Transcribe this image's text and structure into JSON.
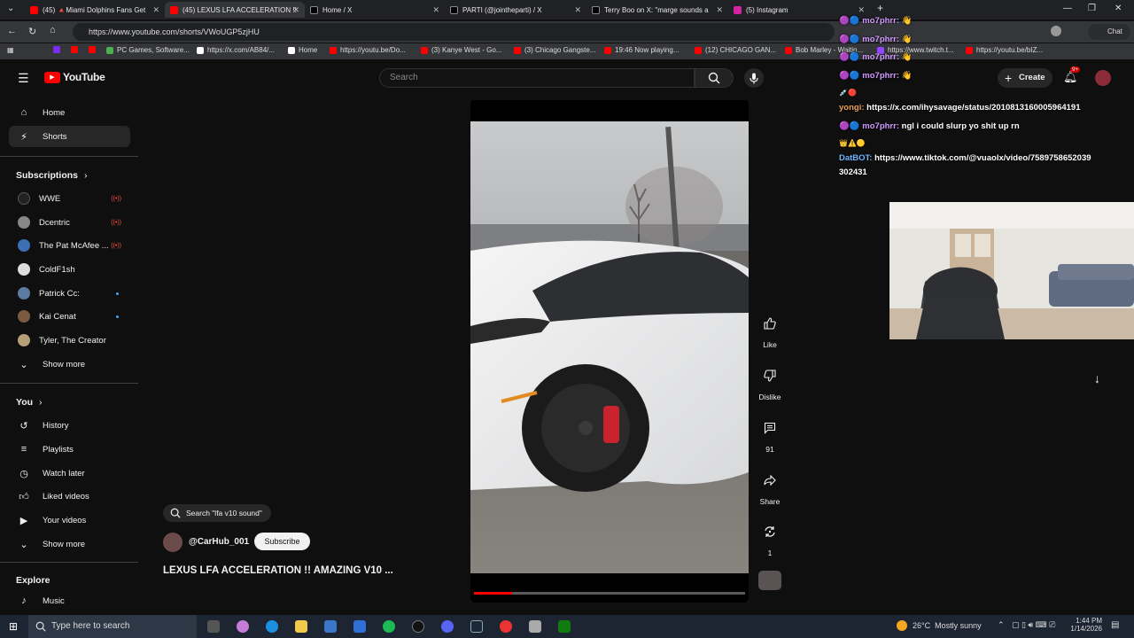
{
  "browser": {
    "tabs": [
      {
        "title": "(45) 🔺Miami Dolphins Fans Get",
        "color": "#ff0000"
      },
      {
        "title": "(45) LEXUS LFA ACCELERATION !!",
        "color": "#ff0000"
      },
      {
        "title": "Home / X",
        "color": "#000000"
      },
      {
        "title": "PARTI (@jointheparti) / X",
        "color": "#000000"
      },
      {
        "title": "Terry Boo on X: \"marge sounds a",
        "color": "#000000"
      },
      {
        "title": "(5) Instagram",
        "color": "#d6249f"
      }
    ],
    "url": "https://www.youtube.com/shorts/VWoUGP5zjHU",
    "bookmarks": [
      "PC Games, Software...",
      "https://x.com/AB84/...",
      "Home",
      "https://youtu.be/Do...",
      "(3) Kanye West - Go...",
      "(3) Chicago Gangste...",
      "19:46 Now playing...",
      "(12) CHICAGO GAN...",
      "Bob Marley - Waitin...",
      "https://www.twitch.t...",
      "https://youtu.be/bIZ..."
    ],
    "chat_button": "Chat"
  },
  "youtube": {
    "logo": "YouTube",
    "search_placeholder": "Search",
    "create_label": "Create",
    "notif_count": "9+",
    "nav": [
      {
        "label": "Home",
        "icon": "home-icon"
      },
      {
        "label": "Shorts",
        "icon": "shorts-icon"
      }
    ],
    "subscriptions_header": "Subscriptions",
    "subscriptions": [
      {
        "label": "WWE",
        "status": "live"
      },
      {
        "label": "Dcentric",
        "status": "live"
      },
      {
        "label": "The Pat McAfee ...",
        "status": "live"
      },
      {
        "label": "ColdF1sh",
        "status": ""
      },
      {
        "label": "Patrick Cc:",
        "status": "new"
      },
      {
        "label": "Kai Cenat",
        "status": "new"
      },
      {
        "label": "Tyler, The Creator",
        "status": ""
      }
    ],
    "show_more": "Show more",
    "you_header": "You",
    "you_items": [
      {
        "label": "History",
        "icon": "history-icon"
      },
      {
        "label": "Playlists",
        "icon": "playlists-icon"
      },
      {
        "label": "Watch later",
        "icon": "watch-later-icon"
      },
      {
        "label": "Liked videos",
        "icon": "liked-icon"
      },
      {
        "label": "Your videos",
        "icon": "your-videos-icon"
      }
    ],
    "show_more_2": "Show more",
    "explore_header": "Explore",
    "explore_items": [
      {
        "label": "Music",
        "icon": "music-icon"
      }
    ],
    "short": {
      "search_chip": "Search \"lfa v10 sound\"",
      "channel": "@CarHub_001",
      "subscribe": "Subscribe",
      "title": "LEXUS LFA ACCELERATION !! AMAZING V10 ...",
      "progress": 0.14
    },
    "actions": {
      "like": "Like",
      "dislike": "Dislike",
      "comments": "91",
      "share": "Share",
      "remix": "1"
    }
  },
  "chat": [
    {
      "name": "mo7phrr:",
      "text": "👋"
    },
    {
      "name": "mo7phrr:",
      "text": "👋"
    },
    {
      "name": "mo7phrr:",
      "text": "👋"
    },
    {
      "name": "mo7phrr:",
      "text": "👋"
    },
    {
      "name": "yongi:",
      "text": "https://x.com/ihysavage/status/2010813160005964191"
    },
    {
      "name": "mo7phrr:",
      "text": "ngl i could slurp yo shit up rn"
    },
    {
      "name": "DatBOT:",
      "text": "https://www.tiktok.com/@vuaolx/video/7589758652039"
    },
    {
      "name": "",
      "text": "302431"
    }
  ],
  "taskbar": {
    "search_placeholder": "Type here to search",
    "weather": "26°C  Mostly sunny",
    "time": "1:44 PM",
    "date": "1/14/2026"
  },
  "colors": {
    "youtube_red": "#ff0000",
    "bg": "#0f0f0f",
    "accent_blue": "#3ea6ff"
  }
}
